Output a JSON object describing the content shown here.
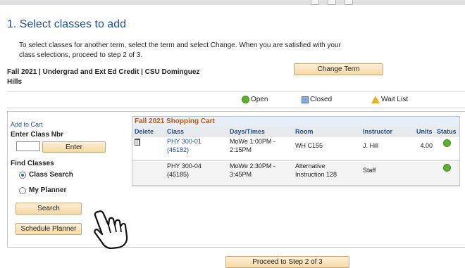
{
  "page": {
    "title": "1.  Select classes to add",
    "instructions": "To select classes for another term, select the term and select Change.  When you are satisfied with your class selections, proceed to step 2 of 3.",
    "term_line1": "Fall 2021 | Undergrad and Ext Ed Credit | CSU Dominguez",
    "term_line2": "Hills",
    "change_term_label": "Change Term"
  },
  "legend": {
    "open": "Open",
    "closed": "Closed",
    "wait_list": "Wait List"
  },
  "left_panel": {
    "add_to_cart": "Add to Cart",
    "enter_class_nbr": "Enter Class Nbr",
    "class_nbr_value": "",
    "enter_label": "Enter",
    "find_classes": "Find Classes",
    "class_search": "Class Search",
    "my_planner": "My Planner",
    "search_label": "Search",
    "schedule_planner_label": "Schedule Planner"
  },
  "cart": {
    "title": "Fall 2021 Shopping Cart",
    "headers": [
      "Delete",
      "Class",
      "Days/Times",
      "Room",
      "Instructor",
      "Units",
      "Status"
    ],
    "rows": [
      {
        "class_line1": "PHY 300-01",
        "class_line2": "(45182)",
        "days_line1": "MoWe 1:00PM -",
        "days_line2": "2:15PM",
        "room_line1": "WH C155",
        "room_line2": "",
        "instructor": "J. Hill",
        "units": "4.00",
        "status": "Open"
      },
      {
        "class_line1": "PHY 300-04",
        "class_line2": "(45185)",
        "days_line1": "MoWe 2:30PM -",
        "days_line2": "3:45PM",
        "room_line1": "Alternative",
        "room_line2": "Instruction 128",
        "instructor": "Staff",
        "units": "",
        "status": "Open"
      }
    ]
  },
  "footer": {
    "proceed_label": "Proceed to Step 2 of 3"
  },
  "colors": {
    "title_blue": "#1f4e93",
    "cart_title": "#b25a1e",
    "open_green": "#5eb12d",
    "closed_blue": "#8ca7d8",
    "wait_yellow": "#e6b12b",
    "button_bg": "#f6d9a6"
  }
}
